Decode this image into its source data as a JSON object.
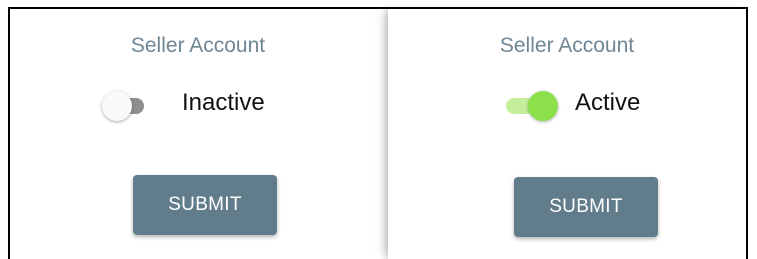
{
  "panels": [
    {
      "heading": "Seller Account",
      "toggle": {
        "state": "off",
        "label": "Inactive"
      },
      "submit_label": "SUBMIT"
    },
    {
      "heading": "Seller Account",
      "toggle": {
        "state": "on",
        "label": "Active"
      },
      "submit_label": "SUBMIT"
    }
  ],
  "colors": {
    "heading": "#6f8696",
    "button": "#617c8b",
    "toggle_on_thumb": "#8ce04a",
    "toggle_on_track": "#c4ee9c",
    "toggle_off_track": "#8e8e8e"
  },
  "icons": {
    "toggle_off": "toggle-off-icon",
    "toggle_on": "toggle-on-icon"
  }
}
